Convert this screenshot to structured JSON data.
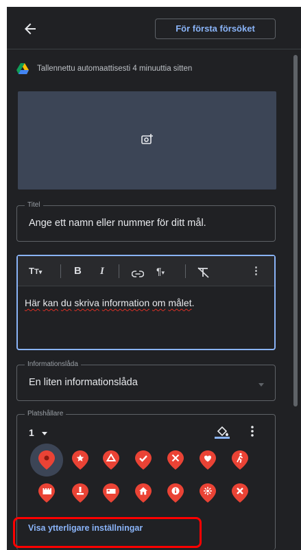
{
  "header": {
    "back_icon": "arrow-back-icon",
    "primary_button_label": "För första försöket"
  },
  "autosave": {
    "icon": "google-drive-icon",
    "text": "Tallennettu automaattisesti 4 minuuttia sitten"
  },
  "photo": {
    "icon": "add-photo-icon"
  },
  "title_field": {
    "label": "Titel",
    "value": "Ange ett namn eller nummer för ditt mål."
  },
  "editor": {
    "toolbar": [
      {
        "name": "text-size-icon",
        "glyph": "TT▾"
      },
      {
        "name": "bold-icon",
        "glyph": "B"
      },
      {
        "name": "italic-icon",
        "glyph": "I"
      },
      {
        "name": "link-icon",
        "glyph": "⊖"
      },
      {
        "name": "paragraph-icon",
        "glyph": "¶▾"
      },
      {
        "name": "clear-format-icon",
        "glyph": "T̸"
      },
      {
        "name": "more-vert-icon",
        "glyph": "⋮"
      }
    ],
    "text_words": [
      "Här",
      "kan",
      "du",
      "skriva",
      "information",
      "om",
      "målet"
    ],
    "text_suffix": "."
  },
  "info_field": {
    "label": "Informationslåda",
    "value": "En liten informationslåda"
  },
  "marker_field": {
    "label": "Platshållare",
    "number": "1",
    "fill_icon": "fill-color-icon",
    "more_icon": "more-vert-icon",
    "pins_row1": [
      "pin-dot-icon",
      "pin-star-icon",
      "pin-triangle-icon",
      "pin-check-icon",
      "pin-restaurant-icon",
      "pin-heart-icon",
      "pin-hiking-icon"
    ],
    "pins_row2": [
      "pin-castle-icon",
      "pin-monument-icon",
      "pin-bed-icon",
      "pin-home-icon",
      "pin-info-icon",
      "pin-flower-icon",
      "pin-close-icon"
    ],
    "pin_color": "#ea4335"
  },
  "more_settings": {
    "label": "Visa ytterligare inställningar"
  },
  "colors": {
    "background": "#202124",
    "accent": "#8ab4f8",
    "highlight": "#ff0000"
  }
}
